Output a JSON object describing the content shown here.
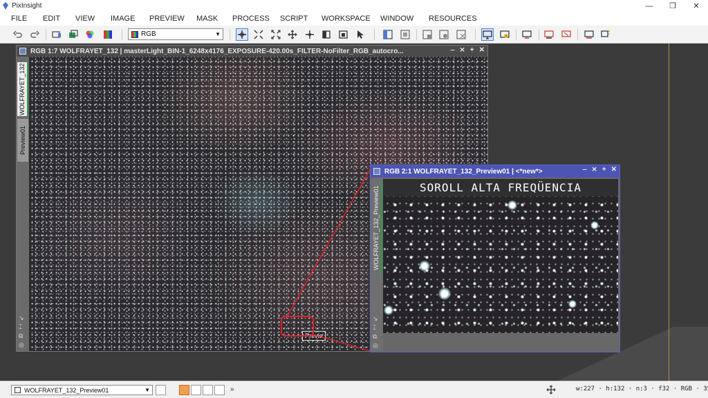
{
  "app": {
    "title": "PixInsight"
  },
  "window_controls": {
    "minimize": "—",
    "restore": "❐",
    "close": "✕"
  },
  "menu": [
    "FILE",
    "EDIT",
    "VIEW",
    "IMAGE",
    "PREVIEW",
    "MASK",
    "PROCESS",
    "SCRIPT",
    "WORKSPACE",
    "WINDOW",
    "RESOURCES"
  ],
  "toolbar": {
    "color_space_select": "RGB"
  },
  "main_window": {
    "title": "RGB 1:7 WOLFRAYET_132 | masterLight_BIN-1_6248x4176_EXPOSURE-420.00s_FILTER-NoFilter_RGB_autocro...",
    "tabs": [
      "WOLFRAYET_132",
      "Preview01"
    ],
    "preview_label": "Previe",
    "controls": [
      "‒",
      "⨯",
      "+",
      "✕"
    ]
  },
  "preview_window": {
    "title": "RGB 2:1 WOLFRAYET_132_Preview01 | <*new*>",
    "tab": "WOLFRAYET_132_Preview01",
    "caption": "SOROLL ALTA FREQÜENCIA",
    "controls": [
      "‒",
      "⨯",
      "+",
      "✕"
    ]
  },
  "statusbar": {
    "view_select": "WOLFRAYET_132_Preview01",
    "more": "»",
    "info": "w:227 · h:132 · n:3 · f32 · RGB · 35:"
  },
  "colors": {
    "highlight": "#e0202a",
    "preview_titlebar": "#4d55b4",
    "accent_line": "#b98a4e"
  }
}
